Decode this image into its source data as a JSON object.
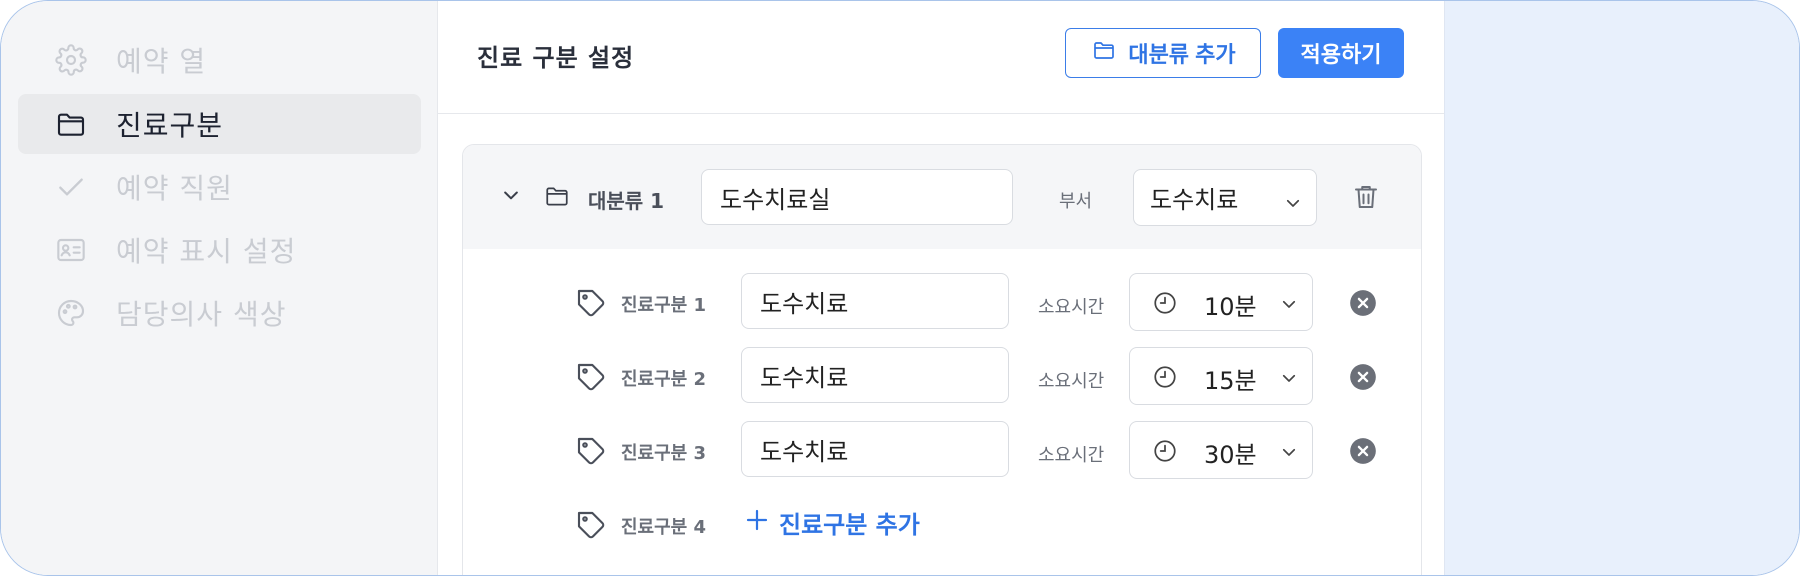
{
  "sidebar": {
    "items": [
      {
        "label": "예약 열",
        "icon": "gear-icon",
        "state": "muted"
      },
      {
        "label": "진료구분",
        "icon": "folder-icon",
        "state": "active"
      },
      {
        "label": "예약 직원",
        "icon": "check-icon",
        "state": "muted"
      },
      {
        "label": "예약 표시 설정",
        "icon": "id-card-icon",
        "state": "muted"
      },
      {
        "label": "담당의사 색상",
        "icon": "palette-icon",
        "state": "muted"
      }
    ]
  },
  "header": {
    "title": "진료 구분 설정",
    "add_category_label": "대분류 추가",
    "apply_label": "적용하기"
  },
  "category": {
    "label": "대분류 1",
    "name_value": "도수치료실",
    "department_label": "부서",
    "department_value": "도수치료"
  },
  "rows": [
    {
      "label": "진료구분 1",
      "name_value": "도수치료",
      "time_label": "소요시간",
      "duration": "10분"
    },
    {
      "label": "진료구분 2",
      "name_value": "도수치료",
      "time_label": "소요시간",
      "duration": "15분"
    },
    {
      "label": "진료구분 3",
      "name_value": "도수치료",
      "time_label": "소요시간",
      "duration": "30분"
    }
  ],
  "add_row": {
    "label": "진료구분 4",
    "add_label": "진료구분 추가"
  },
  "colors": {
    "accent": "#3b82f6",
    "sidebar_bg": "#f4f5f7",
    "panel_bg": "#e8f0fc"
  }
}
